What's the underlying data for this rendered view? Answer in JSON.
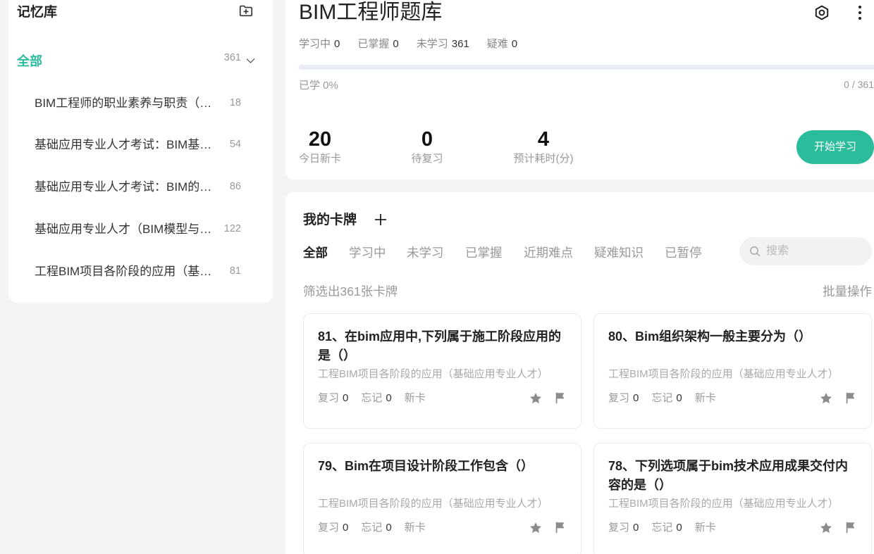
{
  "colors": {
    "accent": "#2bbd9b",
    "background": "#f4f4f4",
    "card_border": "#ebebeb",
    "icon_gray": "#8c8c8c"
  },
  "icons": {
    "sidebar_add": "folder-plus-icon",
    "sidebar_expand": "chevron-down-icon",
    "deck_settings": "settings-icon",
    "deck_more": "more-vertical-icon",
    "cards_add": "plus-icon",
    "search": "search-icon",
    "card_star": "star-icon",
    "card_flag": "flag-icon"
  },
  "sidebar": {
    "title": "记忆库",
    "all": {
      "label": "全部",
      "count": "361",
      "expanded": true
    },
    "items": [
      {
        "label": "BIM工程师的职业素养与职责（…",
        "count": "18"
      },
      {
        "label": "基础应用专业人才考试：BIM基…",
        "count": "54"
      },
      {
        "label": "基础应用专业人才考试：BIM的…",
        "count": "86"
      },
      {
        "label": "基础应用专业人才（BIM模型与…",
        "count": "122"
      },
      {
        "label": "工程BIM项目各阶段的应用（基…",
        "count": "81"
      }
    ]
  },
  "deck": {
    "title": "BIM工程师题库",
    "stats": [
      {
        "label": "学习中",
        "value": "0"
      },
      {
        "label": "已掌握",
        "value": "0"
      },
      {
        "label": "未学习",
        "value": "361"
      },
      {
        "label": "疑难",
        "value": "0"
      }
    ],
    "progress": {
      "label": "已学 0%",
      "fraction": 0,
      "count_text": "0 / 361"
    },
    "summary": [
      {
        "value": "20",
        "label": "今日新卡"
      },
      {
        "value": "0",
        "label": "待复习"
      },
      {
        "value": "4",
        "label": "预计耗时(分)"
      }
    ],
    "start_button": "开始学习"
  },
  "cards_section": {
    "title": "我的卡牌",
    "tabs": [
      {
        "label": "全部",
        "active": true
      },
      {
        "label": "学习中",
        "active": false
      },
      {
        "label": "未学习",
        "active": false
      },
      {
        "label": "已掌握",
        "active": false
      },
      {
        "label": "近期难点",
        "active": false
      },
      {
        "label": "疑难知识",
        "active": false
      },
      {
        "label": "已暂停",
        "active": false
      }
    ],
    "search_placeholder": "搜索",
    "filter_text": "筛选出361张卡牌",
    "bulk_action": "批量操作",
    "cards": [
      {
        "title": "81、在bim应用中,下列属于施工阶段应用的是（）",
        "subtitle": "工程BIM项目各阶段的应用（基础应用专业人才）",
        "review_label": "复习",
        "review_count": "0",
        "forget_label": "忘记",
        "forget_count": "0",
        "status": "新卡"
      },
      {
        "title": "80、Bim组织架构一般主要分为（）",
        "subtitle": "工程BIM项目各阶段的应用（基础应用专业人才）",
        "review_label": "复习",
        "review_count": "0",
        "forget_label": "忘记",
        "forget_count": "0",
        "status": "新卡"
      },
      {
        "title": "79、Bim在项目设计阶段工作包含（）",
        "subtitle": "工程BIM项目各阶段的应用（基础应用专业人才）",
        "review_label": "复习",
        "review_count": "0",
        "forget_label": "忘记",
        "forget_count": "0",
        "status": "新卡"
      },
      {
        "title": "78、下列选项属于bim技术应用成果交付内容的是（）",
        "subtitle": "工程BIM项目各阶段的应用（基础应用专业人才）",
        "review_label": "复习",
        "review_count": "0",
        "forget_label": "忘记",
        "forget_count": "0",
        "status": "新卡"
      }
    ]
  }
}
